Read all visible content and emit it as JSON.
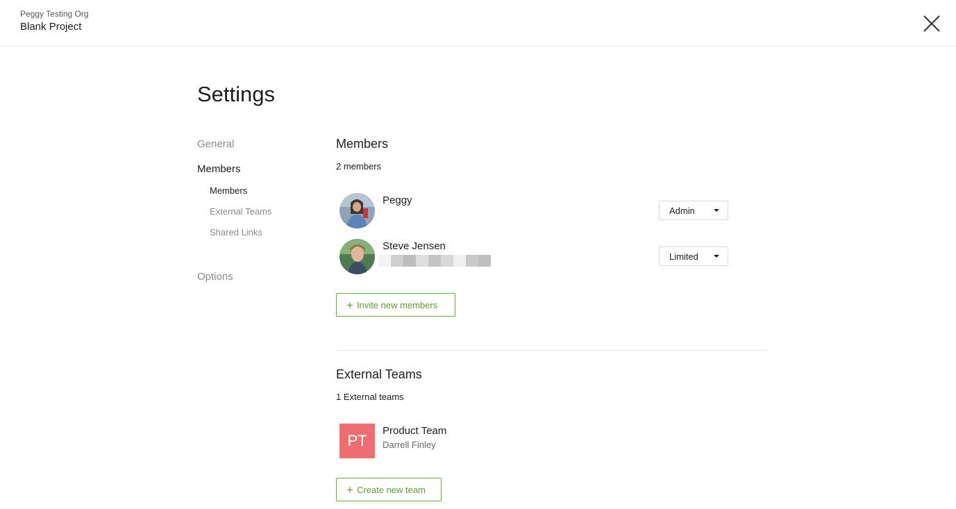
{
  "header": {
    "org_name": "Peggy Testing Org",
    "project_name": "Blank Project",
    "close_icon": "close-icon"
  },
  "page": {
    "title": "Settings"
  },
  "sidebar": {
    "items": [
      {
        "label": "General"
      },
      {
        "label": "Members"
      },
      {
        "label": "Options"
      }
    ],
    "sub_items": [
      {
        "label": "Members"
      },
      {
        "label": "External Teams"
      },
      {
        "label": "Shared Links"
      }
    ]
  },
  "members_section": {
    "title": "Members",
    "count_text": "2 members",
    "members": [
      {
        "name": "Peggy",
        "role": "Admin"
      },
      {
        "name": "Steve Jensen",
        "role": "Limited"
      }
    ],
    "invite_label": "Invite new members"
  },
  "teams_section": {
    "title": "External Teams",
    "count_text": "1 External teams",
    "teams": [
      {
        "initials": "PT",
        "name": "Product Team",
        "owner": "Darrell Finley",
        "color": "#ee6e6f"
      }
    ],
    "create_label": "Create new team"
  },
  "colors": {
    "accent_green": "#5e9e2f",
    "team_badge": "#ee6e6f"
  }
}
